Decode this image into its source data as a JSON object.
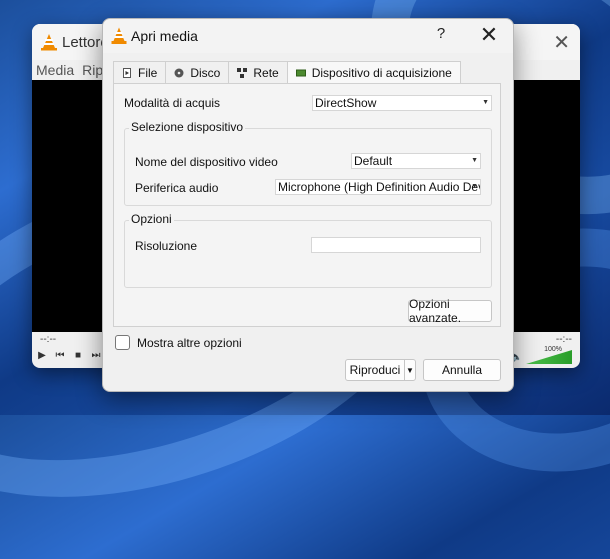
{
  "background_window": {
    "title": "Lettore",
    "menu": [
      "Media",
      "Rip"
    ],
    "time_left": "--:--",
    "time_right": "--:--",
    "volume": "100%"
  },
  "dialog": {
    "title": "Apri media",
    "help": "?",
    "close": "✕",
    "tabs": [
      {
        "label": "File",
        "icon": "file-icon"
      },
      {
        "label": "Disco",
        "icon": "disc-icon"
      },
      {
        "label": "Rete",
        "icon": "network-icon"
      },
      {
        "label": "Dispositivo di acquisizione",
        "icon": "capture-device-icon",
        "active": true
      }
    ],
    "capture_mode": {
      "label": "Modalità di acquis",
      "value": "DirectShow"
    },
    "device_group": {
      "title": "Selezione dispositivo",
      "video_label": "Nome del dispositivo video",
      "video_value": "Default",
      "audio_label": "Periferica audio",
      "audio_value": "Microphone (High Definition Audio Dev"
    },
    "options_group": {
      "title": "Opzioni",
      "resolution_label": "Risoluzione",
      "resolution_value": ""
    },
    "advanced_button": "Opzioni avanzate.",
    "more_options_label": "Mostra altre opzioni",
    "play_button": "Riproduci",
    "cancel_button": "Annulla"
  }
}
